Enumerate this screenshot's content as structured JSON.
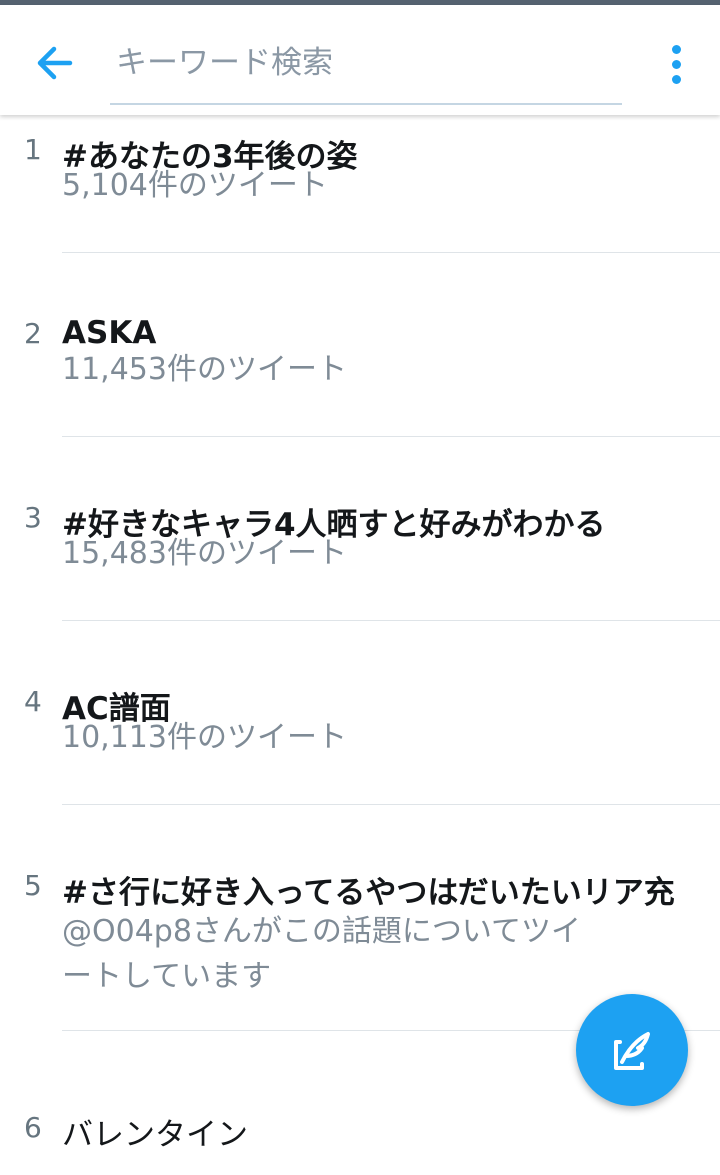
{
  "header": {
    "search_placeholder": "キーワード検索",
    "back_icon": "arrow-left-icon",
    "overflow_icon": "more-vertical-icon",
    "accent_color": "#1da1f2"
  },
  "trends": [
    {
      "rank": "1",
      "title": "#あなたの3年後の姿",
      "meta": "5,104件のツイート"
    },
    {
      "rank": "2",
      "title": "ASKA",
      "meta": "11,453件のツイート"
    },
    {
      "rank": "3",
      "title": "#好きなキャラ4人晒すと好みがわかる",
      "meta": "15,483件のツイート"
    },
    {
      "rank": "4",
      "title": "AC譜面",
      "meta": "10,113件のツイート"
    },
    {
      "rank": "5",
      "title": "#さ行に好き入ってるやつはだいたいリア充",
      "meta": "@O04p8さんがこの話題についてツイートしています"
    },
    {
      "rank": "6",
      "title": "バレンタイン",
      "meta": ""
    }
  ],
  "fab": {
    "icon": "compose-tweet-icon"
  }
}
